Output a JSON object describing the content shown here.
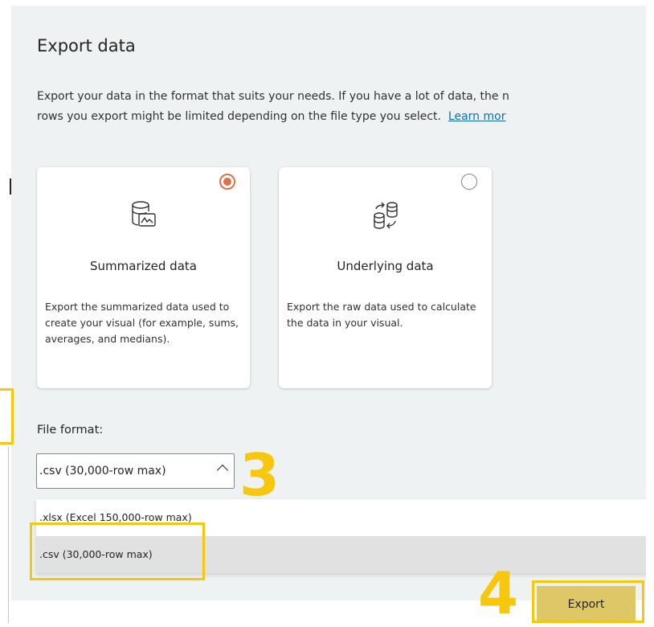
{
  "dialog": {
    "title": "Export data",
    "description_line1": "Export your data in the format that suits your needs. If you have a lot of data, the n",
    "description_line2": "rows you export might be limited depending on the file type you select.",
    "learn_more": "Learn mor"
  },
  "options": [
    {
      "title": "Summarized data",
      "description": "Export the summarized data used to create your visual (for example, sums, averages, and medians).",
      "selected": true,
      "icon": "database-chart-icon"
    },
    {
      "title": "Underlying data",
      "description": "Export the raw data used to calculate the data in your visual.",
      "selected": false,
      "icon": "database-transfer-icon"
    }
  ],
  "file_format": {
    "label": "File format:",
    "selected": ".csv (30,000-row max)",
    "options": [
      ".xlsx (Excel 150,000-row max)",
      ".csv (30,000-row max)"
    ]
  },
  "export_button": "Export",
  "annotations": {
    "step3": "3",
    "step4": "4"
  },
  "colors": {
    "accent": "#e07047",
    "highlight": "#f6c70c",
    "export_bg": "#ddc767",
    "link": "#0f6cbd"
  }
}
